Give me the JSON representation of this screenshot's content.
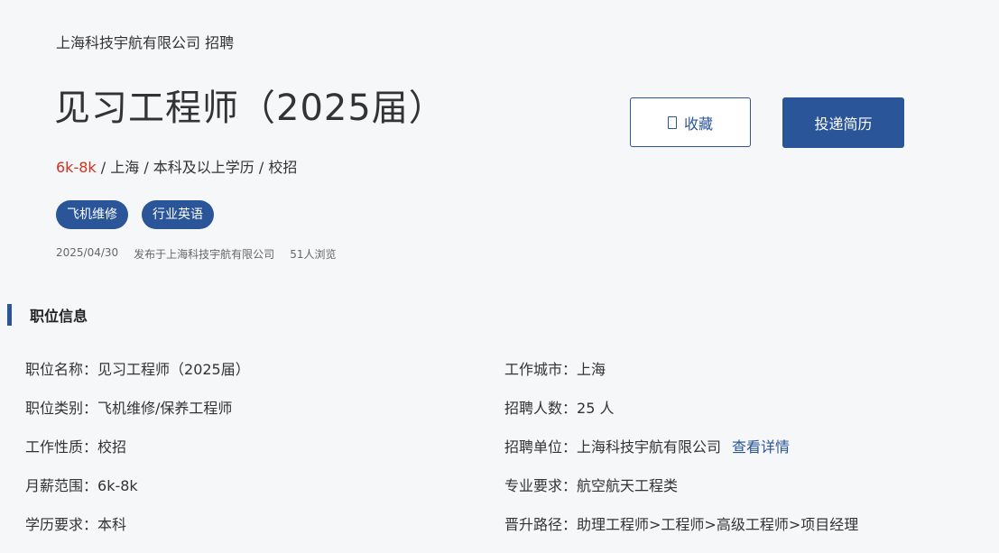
{
  "header": {
    "company_line": "上海科技宇航有限公司 招聘",
    "job_title": "见习工程师（2025届）",
    "salary": "6k-8k",
    "meta_rest": " / 上海 / 本科及以上学历 / 校招",
    "tags": [
      "飞机维修",
      "行业英语"
    ],
    "publish_date": "2025/04/30",
    "publisher": "发布于上海科技宇航有限公司",
    "views": "51人浏览"
  },
  "actions": {
    "favorite_label": "收藏",
    "apply_label": "投递简历"
  },
  "section": {
    "title": "职位信息"
  },
  "info_left": [
    {
      "label": "职位名称：",
      "value": "见习工程师（2025届）"
    },
    {
      "label": "职位类别：",
      "value": "飞机维修/保养工程师"
    },
    {
      "label": "工作性质：",
      "value": "校招"
    },
    {
      "label": "月薪范围：",
      "value": "6k-8k"
    },
    {
      "label": "学历要求：",
      "value": "本科"
    }
  ],
  "info_right": [
    {
      "label": "工作城市：",
      "value": "上海"
    },
    {
      "label": "招聘人数：",
      "value": "25 人"
    },
    {
      "label": "招聘单位：",
      "value": "上海科技宇航有限公司",
      "link": "查看详情"
    },
    {
      "label": "专业要求：",
      "value": "航空航天工程类"
    },
    {
      "label": "晋升路径：",
      "value": "助理工程师>工程师>高级工程师>项目经理"
    }
  ],
  "colors": {
    "accent": "#2a5598",
    "salary": "#d0321f"
  }
}
